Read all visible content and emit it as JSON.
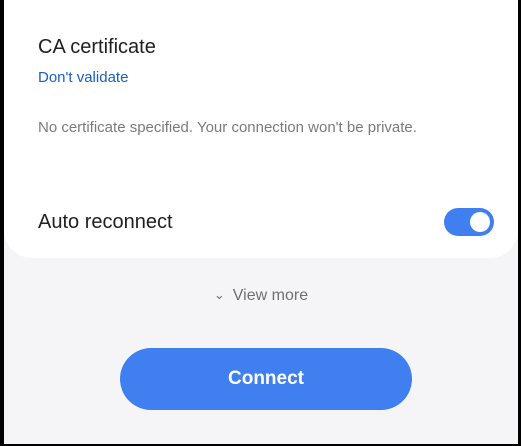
{
  "ca_certificate": {
    "title": "CA certificate",
    "value": "Don't validate",
    "description": "No certificate specified. Your connection won't be private."
  },
  "auto_reconnect": {
    "label": "Auto reconnect",
    "enabled": true
  },
  "view_more": {
    "label": "View more",
    "icon": "chevron-down-icon"
  },
  "connect_button": {
    "label": "Connect"
  },
  "colors": {
    "accent": "#3f7ff0",
    "link": "#1a5fbd",
    "card_background": "#ffffff",
    "page_background": "#f5f5f7"
  }
}
